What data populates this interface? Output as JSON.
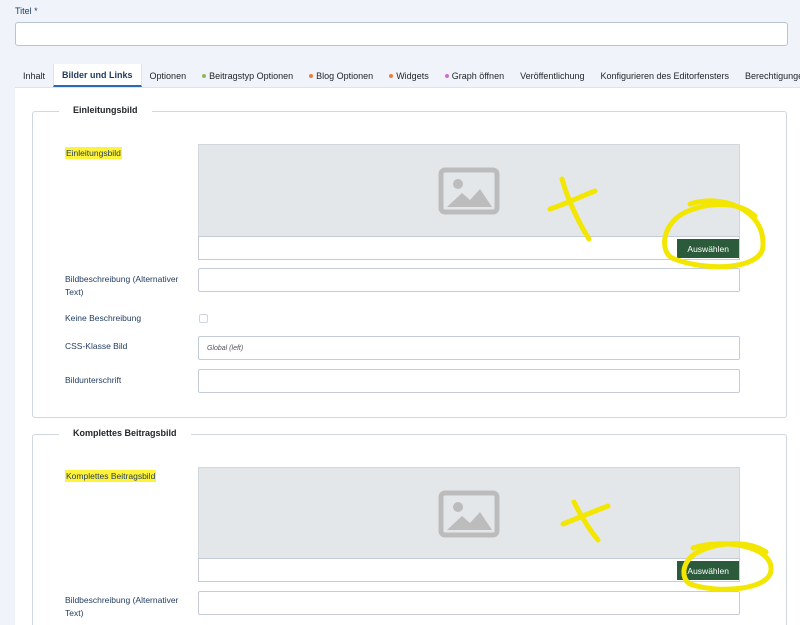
{
  "title": {
    "label": "Titel *",
    "value": ""
  },
  "tabs": [
    {
      "label": "Inhalt",
      "dot": ""
    },
    {
      "label": "Bilder und Links",
      "dot": "",
      "active": true
    },
    {
      "label": "Optionen",
      "dot": ""
    },
    {
      "label": "Beitragstyp Optionen",
      "dot": "#8db85e"
    },
    {
      "label": "Blog Optionen",
      "dot": "#f07b3b"
    },
    {
      "label": "Widgets",
      "dot": "#f07b3b"
    },
    {
      "label": "Graph öffnen",
      "dot": "#d46ad9"
    },
    {
      "label": "Veröffentlichung",
      "dot": ""
    },
    {
      "label": "Konfigurieren des Editorfensters",
      "dot": ""
    },
    {
      "label": "Berechtigungen",
      "dot": ""
    }
  ],
  "intro": {
    "legend": "Einleitungsbild",
    "image_label": "Einleitungsbild",
    "select_button": "Auswählen",
    "alt_label_line1": "Bildbeschreibung (Alternativer",
    "alt_label_line2": "Text)",
    "no_desc_label": "Keine Beschreibung",
    "css_label": "CSS-Klasse Bild",
    "css_placeholder": "Global (left)",
    "caption_label": "Bildunterschrift"
  },
  "full": {
    "legend": "Komplettes Beitragsbild",
    "image_label": "Komplettes Beitragsbild",
    "select_button": "Auswählen",
    "alt_label_line1": "Bildbeschreibung (Alternativer",
    "alt_label_line2": "Text)"
  },
  "colors": {
    "accent": "#2a69b8",
    "button": "#2b5b3a",
    "highlight": "#fff33a",
    "annotation": "#f3e600"
  },
  "icons": {
    "placeholder": "image-placeholder-icon"
  }
}
